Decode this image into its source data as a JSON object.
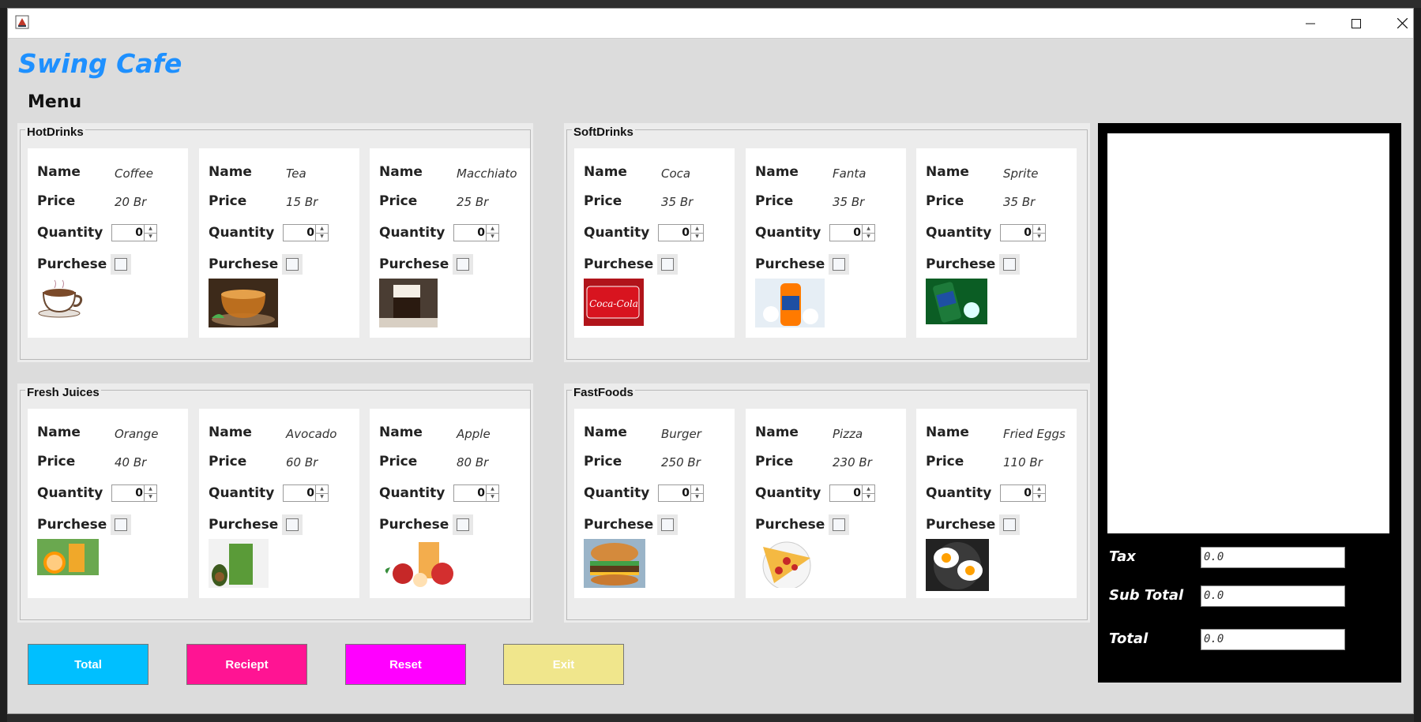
{
  "window": {
    "title": "",
    "controls": {
      "minimize": "—",
      "maximize": "☐",
      "close": "✕"
    }
  },
  "brand": "Swing Cafe",
  "menu_title": "Menu",
  "labels": {
    "name": "Name",
    "price": "Price",
    "quantity": "Quantity",
    "purchase": "Purchese"
  },
  "sections": [
    {
      "title": "HotDrinks",
      "items": [
        {
          "name": "Coffee",
          "price": "20 Br",
          "quantity": "0",
          "icon": "coffee-image"
        },
        {
          "name": "Tea",
          "price": "15 Br",
          "quantity": "0",
          "icon": "tea-image"
        },
        {
          "name": "Macchiato",
          "price": "25 Br",
          "quantity": "0",
          "icon": "macchiato-image"
        }
      ]
    },
    {
      "title": "SoftDrinks",
      "items": [
        {
          "name": "Coca",
          "price": "35 Br",
          "quantity": "0",
          "icon": "coca-image"
        },
        {
          "name": "Fanta",
          "price": "35 Br",
          "quantity": "0",
          "icon": "fanta-image"
        },
        {
          "name": "Sprite",
          "price": "35 Br",
          "quantity": "0",
          "icon": "sprite-image"
        }
      ]
    },
    {
      "title": "Fresh Juices",
      "items": [
        {
          "name": "Orange",
          "price": "40 Br",
          "quantity": "0",
          "icon": "orange-image"
        },
        {
          "name": "Avocado",
          "price": "60 Br",
          "quantity": "0",
          "icon": "avocado-image"
        },
        {
          "name": "Apple",
          "price": "80 Br",
          "quantity": "0",
          "icon": "apple-image"
        }
      ]
    },
    {
      "title": "FastFoods",
      "items": [
        {
          "name": "Burger",
          "price": "250 Br",
          "quantity": "0",
          "icon": "burger-image"
        },
        {
          "name": "Pizza",
          "price": "230 Br",
          "quantity": "0",
          "icon": "pizza-image"
        },
        {
          "name": "Fried Eggs",
          "price": "110 Br",
          "quantity": "0",
          "icon": "fried-eggs-image"
        }
      ]
    }
  ],
  "summary": {
    "tax_label": "Tax",
    "tax_value": "0.0",
    "subtotal_label": "Sub Total",
    "subtotal_value": "0.0",
    "total_label": "Total",
    "total_value": "0.0"
  },
  "buttons": {
    "total": "Total",
    "receipt": "Reciept",
    "reset": "Reset",
    "exit": "Exit"
  },
  "colors": {
    "brand": "#1e90ff",
    "total_button": "#00bfff",
    "receipt_button": "#ff1493",
    "reset_button": "#ff00ff",
    "exit_button": "#f0e68c"
  }
}
